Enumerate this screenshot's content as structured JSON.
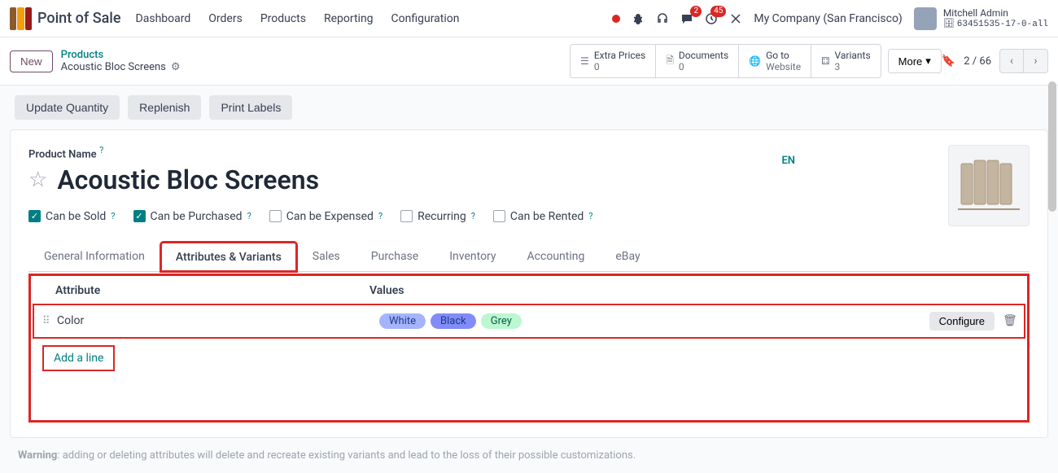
{
  "app": {
    "title": "Point of Sale"
  },
  "nav": {
    "items": [
      "Dashboard",
      "Orders",
      "Products",
      "Reporting",
      "Configuration"
    ]
  },
  "topright": {
    "chat_badge": "2",
    "activity_badge": "45",
    "company": "My Company (San Francisco)",
    "user_name": "Mitchell Admin",
    "db": "63451535-17-0-all"
  },
  "ctrl": {
    "new_btn": "New",
    "bc_parent": "Products",
    "bc_current": "Acoustic Bloc Screens",
    "stats": [
      {
        "label": "Extra Prices",
        "val": "0"
      },
      {
        "label": "Documents",
        "val": "0"
      },
      {
        "label": "Go to",
        "val": "Website"
      },
      {
        "label": "Variants",
        "val": "3"
      }
    ],
    "more": "More",
    "pager": "2 / 66"
  },
  "actions": {
    "update_qty": "Update Quantity",
    "replenish": "Replenish",
    "print_labels": "Print Labels"
  },
  "form": {
    "name_label": "Product Name",
    "product_name": "Acoustic Bloc Screens",
    "lang": "EN",
    "checks": {
      "sold": "Can be Sold",
      "purchased": "Can be Purchased",
      "expensed": "Can be Expensed",
      "recurring": "Recurring",
      "rented": "Can be Rented"
    },
    "tabs": {
      "general": "General Information",
      "attrs": "Attributes & Variants",
      "sales": "Sales",
      "purchase": "Purchase",
      "inventory": "Inventory",
      "accounting": "Accounting",
      "ebay": "eBay"
    },
    "attr_table": {
      "col_attr": "Attribute",
      "col_vals": "Values",
      "row_attr": "Color",
      "vals": [
        "White",
        "Black",
        "Grey"
      ],
      "configure": "Configure",
      "add_line": "Add a line"
    }
  },
  "warning_label": "Warning",
  "warning_text": ": adding or deleting attributes will delete and recreate existing variants and lead to the loss of their possible customizations."
}
